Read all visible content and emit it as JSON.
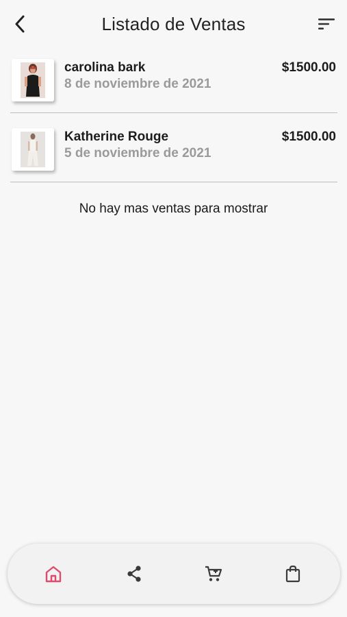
{
  "header": {
    "title": "Listado de Ventas",
    "back_icon": "chevron-left-icon",
    "filter_icon": "sort-icon"
  },
  "sales": [
    {
      "name": "carolina bark",
      "date": "8 de noviembre de 2021",
      "price": "$1500.00"
    },
    {
      "name": "Katherine Rouge",
      "date": "5 de noviembre de 2021",
      "price": "$1500.00"
    }
  ],
  "empty_message": "No hay mas ventas para mostrar",
  "bottom_nav": {
    "items": [
      "home-icon",
      "share-icon",
      "cart-icon",
      "shopping-bag-icon"
    ],
    "active": "home-icon",
    "active_color": "#e04a6e",
    "inactive_color": "#3a3a3a"
  }
}
